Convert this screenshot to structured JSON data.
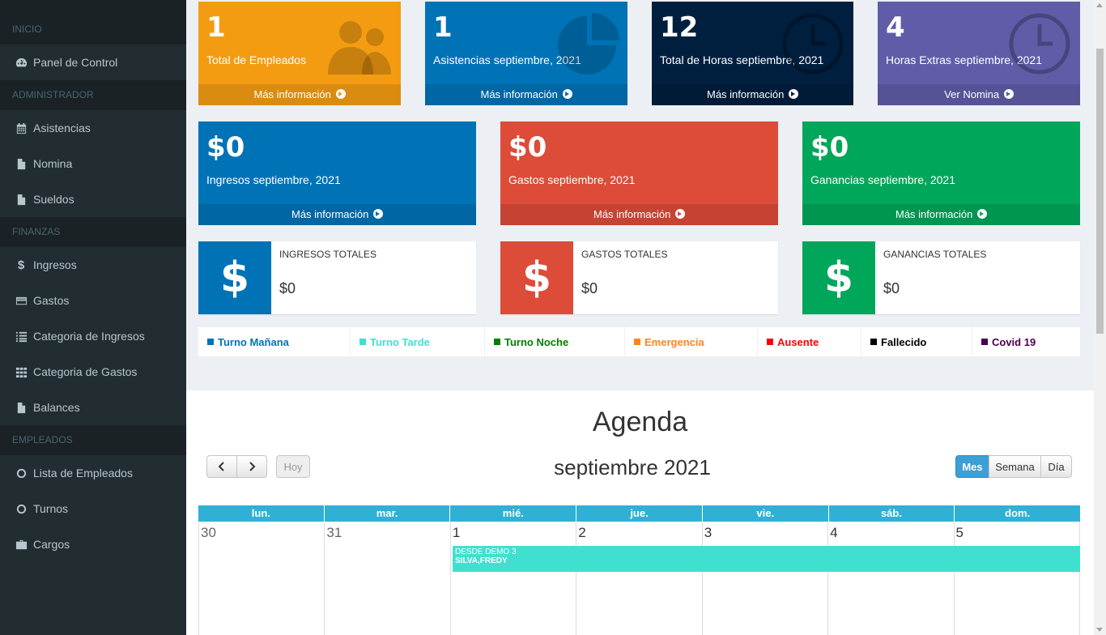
{
  "sidebar": {
    "sections": {
      "inicio": "INICIO",
      "administrador": "ADMINISTRADOR",
      "finanzas": "FINANZAS",
      "empleados": "EMPLEADOS"
    },
    "items": {
      "panel": "Panel de Control",
      "asistencias": "Asistencias",
      "nomina": "Nomina",
      "sueldos": "Sueldos",
      "ingresos": "Ingresos",
      "gastos": "Gastos",
      "cat_ingresos": "Categoria de Ingresos",
      "cat_gastos": "Categoria de Gastos",
      "balances": "Balances",
      "lista_empleados": "Lista de Empleados",
      "turnos": "Turnos",
      "cargos": "Cargos"
    }
  },
  "stats_row1": [
    {
      "value": "1",
      "label": "Total de Empleados",
      "link": "Más información",
      "color": "#f39c12",
      "icon": "users-icon"
    },
    {
      "value": "1",
      "label": "Asistencias septiembre, 2021",
      "link": "Más información",
      "color": "#0073b7",
      "icon": "pie-chart-icon"
    },
    {
      "value": "12",
      "label": "Total de Horas septiembre, 2021",
      "link": "Más información",
      "color": "#001f3f",
      "icon": "clock-icon"
    },
    {
      "value": "4",
      "label": "Horas Extras septiembre, 2021",
      "link": "Ver Nomina",
      "color": "#605ca8",
      "icon": "clock-icon"
    }
  ],
  "stats_row2": [
    {
      "value": "$0",
      "label": "Ingresos septiembre, 2021",
      "link": "Más información",
      "color": "#0073b7"
    },
    {
      "value": "$0",
      "label": "Gastos septiembre, 2021",
      "link": "Más información",
      "color": "#dd4b39"
    },
    {
      "value": "$0",
      "label": "Ganancias septiembre, 2021",
      "link": "Más información",
      "color": "#00a65a"
    }
  ],
  "totals": [
    {
      "title": "INGRESOS TOTALES",
      "value": "$0",
      "symbol": "$",
      "color": "#0073b7"
    },
    {
      "title": "GASTOS TOTALES",
      "value": "$0",
      "symbol": "$",
      "color": "#dd4b39"
    },
    {
      "title": "GANANCIAS TOTALES",
      "value": "$0",
      "symbol": "$",
      "color": "#00a65a"
    }
  ],
  "legend": [
    {
      "label": "Turno Mañana",
      "color": "#0073b7"
    },
    {
      "label": "Turno Tarde",
      "color": "#40e0d0"
    },
    {
      "label": "Turno Noche",
      "color": "#008000"
    },
    {
      "label": "Emergencia",
      "color": "#ff851b"
    },
    {
      "label": "Ausente",
      "color": "#ff0000"
    },
    {
      "label": "Fallecido",
      "color": "#000000"
    },
    {
      "label": "Covid 19",
      "color": "#4b0050"
    }
  ],
  "agenda": {
    "title": "Agenda",
    "month": "septiembre 2021",
    "today_label": "Hoy",
    "views": [
      "Mes",
      "Semana",
      "Día"
    ],
    "weekdays": [
      "lun.",
      "mar.",
      "mié.",
      "jue.",
      "vie.",
      "sáb.",
      "dom."
    ],
    "days": [
      "30",
      "31",
      "1",
      "2",
      "3",
      "4",
      "5"
    ],
    "event": {
      "line1": "DESDE DEMO 3",
      "line2": "SILVA,FREDY"
    }
  }
}
